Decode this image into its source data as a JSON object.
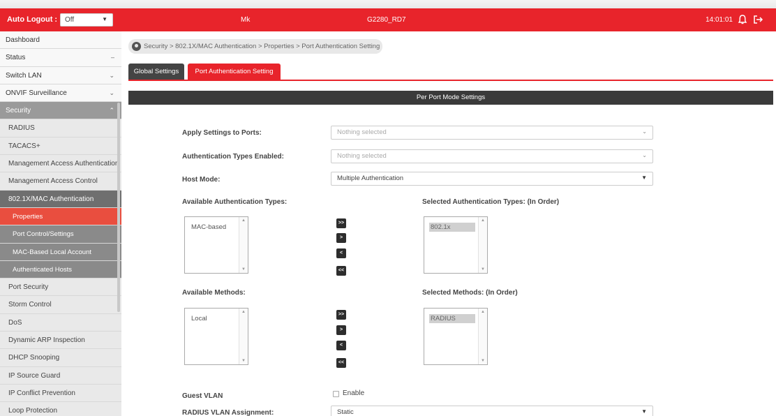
{
  "topbar": {
    "auto_logout_label": "Auto Logout :",
    "auto_logout_value": "Off",
    "user": "Mk",
    "device": "G2280_RD7",
    "time": "14:01:01"
  },
  "sidebar": {
    "items": [
      {
        "label": "Dashboard"
      },
      {
        "label": "Status"
      },
      {
        "label": "Switch LAN"
      },
      {
        "label": "ONVIF Surveillance"
      },
      {
        "label": "Security"
      },
      {
        "label": "RADIUS"
      },
      {
        "label": "TACACS+"
      },
      {
        "label": "Management Access Authentication"
      },
      {
        "label": "Management Access Control"
      },
      {
        "label": "802.1X/MAC Authentication"
      },
      {
        "label": "Properties"
      },
      {
        "label": "Port Control/Settings"
      },
      {
        "label": "MAC-Based Local Account"
      },
      {
        "label": "Authenticated Hosts"
      },
      {
        "label": "Port Security"
      },
      {
        "label": "Storm Control"
      },
      {
        "label": "DoS"
      },
      {
        "label": "Dynamic ARP Inspection"
      },
      {
        "label": "DHCP Snooping"
      },
      {
        "label": "IP Source Guard"
      },
      {
        "label": "IP Conflict Prevention"
      },
      {
        "label": "Loop Protection"
      }
    ]
  },
  "breadcrumb": "Security > 802.1X/MAC Authentication > Properties > Port Authentication Setting",
  "tabs": {
    "global": "Global Settings",
    "port": "Port Authentication Setting"
  },
  "section_title": "Per Port Mode Settings",
  "form": {
    "apply_ports_label": "Apply Settings to Ports:",
    "apply_ports_placeholder": "Nothing selected",
    "auth_types_enabled_label": "Authentication Types Enabled:",
    "auth_types_enabled_placeholder": "Nothing selected",
    "host_mode_label": "Host Mode:",
    "host_mode_value": "Multiple Authentication",
    "available_auth_types_label": "Available Authentication Types:",
    "selected_auth_types_label": "Selected Authentication Types: (In Order)",
    "available_auth_types": [
      "MAC-based"
    ],
    "selected_auth_types": [
      "802.1x"
    ],
    "available_methods_label": "Available Methods:",
    "selected_methods_label": "Selected Methods: (In Order)",
    "available_methods": [
      "Local"
    ],
    "selected_methods": [
      "RADIUS"
    ],
    "move_buttons": {
      "all_right": ">>",
      "right": ">",
      "left": "<",
      "all_left": "<<"
    },
    "guest_vlan_label": "Guest VLAN",
    "guest_vlan_enable": "Enable",
    "radius_vlan_label": "RADIUS VLAN Assignment:",
    "radius_vlan_value": "Static"
  }
}
